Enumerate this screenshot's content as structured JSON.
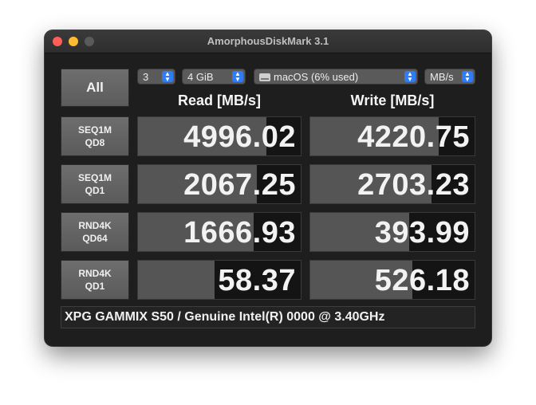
{
  "window": {
    "title": "AmorphousDiskMark 3.1"
  },
  "controls": {
    "all_label": "All",
    "count": "3",
    "size": "4 GiB",
    "drive": "macOS (6% used)",
    "unit": "MB/s"
  },
  "headers": {
    "read": "Read [MB/s]",
    "write": "Write [MB/s]"
  },
  "rows": [
    {
      "name1": "SEQ1M",
      "name2": "QD8",
      "read": "4996.02",
      "write": "4220.75",
      "read_fill": 0.79,
      "write_fill": 0.78
    },
    {
      "name1": "SEQ1M",
      "name2": "QD1",
      "read": "2067.25",
      "write": "2703.23",
      "read_fill": 0.73,
      "write_fill": 0.74
    },
    {
      "name1": "RND4K",
      "name2": "QD64",
      "read": "1666.93",
      "write": "393.99",
      "read_fill": 0.71,
      "write_fill": 0.6
    },
    {
      "name1": "RND4K",
      "name2": "QD1",
      "read": "58.37",
      "write": "526.18",
      "read_fill": 0.47,
      "write_fill": 0.62
    }
  ],
  "footer": "XPG GAMMIX S50 / Genuine Intel(R) 0000 @ 3.40GHz",
  "colors": {
    "stepper": "#2f7cf6",
    "bar": "#555555",
    "cell_bg": "#141414"
  }
}
